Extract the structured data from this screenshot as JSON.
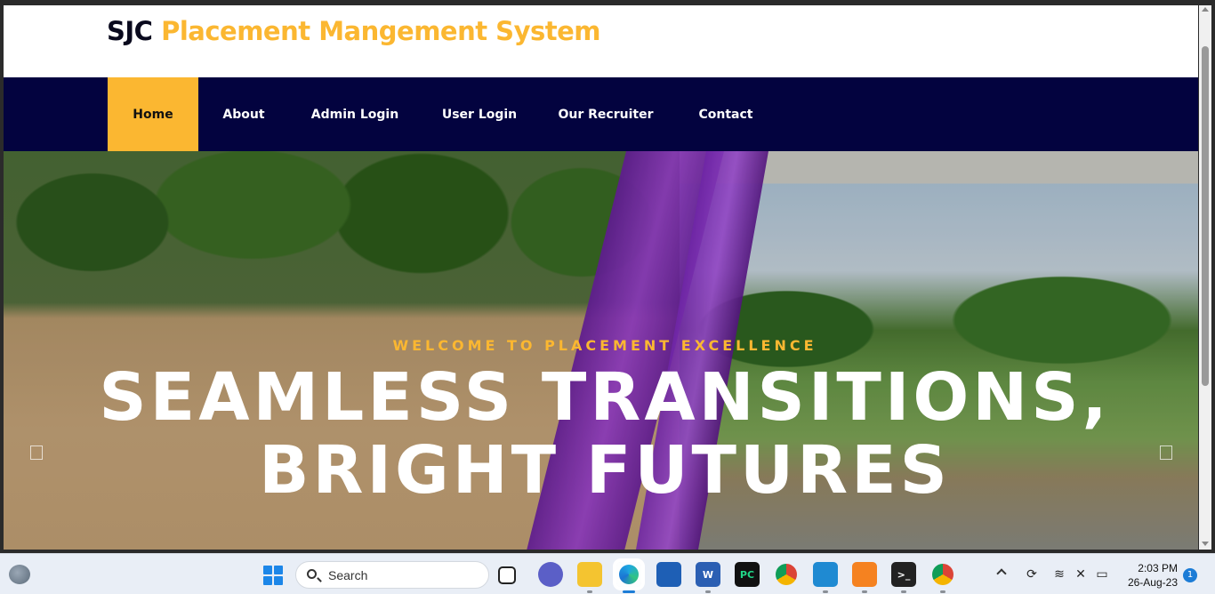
{
  "site": {
    "brand_prefix": "SJC",
    "brand_rest": "Placement Mangement System",
    "colors": {
      "accent": "#fbb731",
      "nav_bg": "#03033f",
      "brand_dark": "#0a0a1e"
    }
  },
  "nav": {
    "items": [
      {
        "label": "Home",
        "active": true
      },
      {
        "label": "About"
      },
      {
        "label": "Admin Login"
      },
      {
        "label": "User Login"
      },
      {
        "label": "Our Recruiter"
      },
      {
        "label": "Contact"
      }
    ]
  },
  "hero": {
    "eyebrow": "WELCOME TO PLACEMENT EXCELLENCE",
    "headline": "SEAMLESS TRANSITIONS, BRIGHT FUTURES"
  },
  "taskbar": {
    "search_label": "Search",
    "apps": [
      {
        "name": "task-view-icon"
      },
      {
        "name": "teams-chat-icon"
      },
      {
        "name": "file-explorer-icon"
      },
      {
        "name": "edge-icon",
        "active": true
      },
      {
        "name": "microsoft-store-icon"
      },
      {
        "name": "word-icon",
        "glyph": "W"
      },
      {
        "name": "pycharm-icon",
        "glyph": "PC"
      },
      {
        "name": "chrome-icon"
      },
      {
        "name": "vscode-icon"
      },
      {
        "name": "xampp-icon"
      },
      {
        "name": "terminal-icon",
        "glyph": ">_"
      },
      {
        "name": "chrome-profile-icon"
      }
    ],
    "tray": {
      "time": "2:03 PM",
      "date": "26-Aug-23",
      "notifications": "1"
    }
  }
}
